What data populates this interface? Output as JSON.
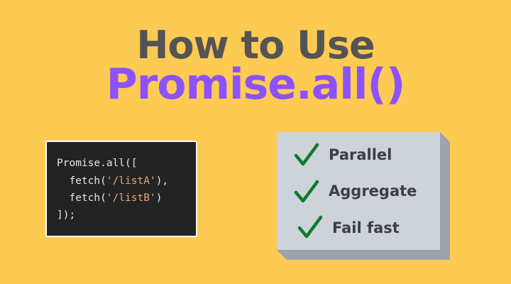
{
  "title": {
    "line1": "How to Use",
    "line2": "Promise.all()"
  },
  "colors": {
    "background": "#fdca52",
    "title_line1": "#545454",
    "title_line2": "#8c52ff",
    "code_background": "#232323",
    "code_text": "#e6e6e6",
    "code_string": "#e0a77b",
    "card_front": "#cdd3d8",
    "card_side": "#9ca3aa",
    "check": "#0f7a2e",
    "feature_text": "#3b3e44"
  },
  "code": {
    "lines": [
      [
        {
          "t": "Promise.all([",
          "k": "plain"
        }
      ],
      [
        {
          "t": "  fetch(",
          "k": "plain"
        },
        {
          "t": "'/listA'",
          "k": "str"
        },
        {
          "t": "),",
          "k": "plain"
        }
      ],
      [
        {
          "t": "  fetch(",
          "k": "plain"
        },
        {
          "t": "'/listB'",
          "k": "str"
        },
        {
          "t": ")",
          "k": "plain"
        }
      ],
      [
        {
          "t": "]);",
          "k": "plain"
        }
      ]
    ]
  },
  "features": {
    "icon": "checkmark-icon",
    "items": [
      "Parallel",
      "Aggregate",
      "Fail fast"
    ]
  }
}
